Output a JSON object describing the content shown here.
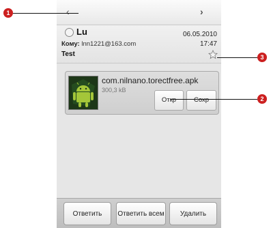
{
  "navigation": {
    "prev_icon": "chevron-left-icon",
    "next_icon": "chevron-right-icon",
    "prev_glyph": "‹",
    "next_glyph": "›"
  },
  "message": {
    "sender": "Lu",
    "to_label": "Кому:",
    "to_address": "lnn1221@163.com",
    "date": "06.05.2010",
    "time": "17:47",
    "subject": "Test"
  },
  "attachment": {
    "name": "com.nilnano.torectfree.apk",
    "size": "300,3 kB",
    "open_label": "Откр",
    "save_label": "Сохр"
  },
  "actions": {
    "reply": "Ответить",
    "reply_all": "Ответить всем",
    "delete": "Удалить"
  },
  "callouts": {
    "one": "1",
    "two": "2",
    "three": "3"
  },
  "colors": {
    "callout": "#cc2020",
    "android_green": "#a4c639"
  }
}
